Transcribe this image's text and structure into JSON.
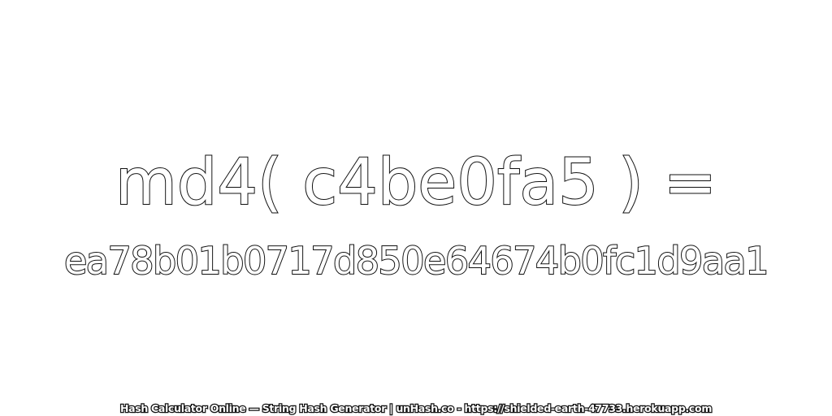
{
  "headline": {
    "expression": "md4( c4be0fa5 ) =",
    "hash": "ea78b01b0717d850e64674b0fc1d9aa1"
  },
  "footer": {
    "text": "Hash Calculator Online — String Hash Generator | unHash.co - https://shielded-earth-47733.herokuapp.com"
  },
  "colors": {
    "background": "#ffffff",
    "text_fill": "#ffffff",
    "text_outline": "#111111"
  }
}
